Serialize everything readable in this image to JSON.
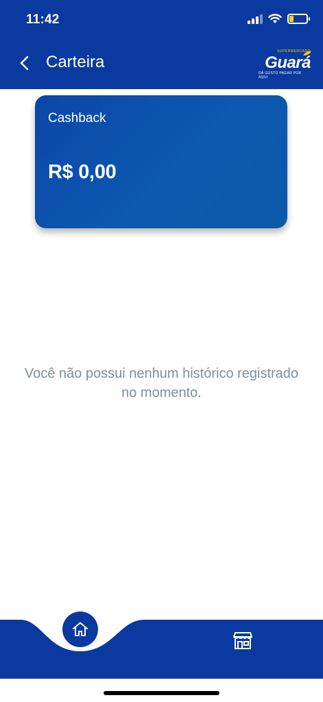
{
  "status_bar": {
    "time": "11:42",
    "icons": [
      "signal-icon",
      "wifi-icon",
      "battery-icon"
    ]
  },
  "header": {
    "title": "Carteira",
    "back_icon": "chevron-left-icon",
    "logo": {
      "wordmark": "Guará",
      "top_text": "SUPERMERCADO",
      "tagline": "DÁ GOSTO PAGAR POR AQUI"
    }
  },
  "cashback_card": {
    "label": "Cashback",
    "value": "R$ 0,00"
  },
  "empty_state": {
    "message": "Você não possui nenhum histórico registrado no momento."
  },
  "bottom_nav": {
    "items": [
      {
        "icon": "home-icon",
        "active": true
      },
      {
        "icon": "store-icon",
        "active": false
      }
    ]
  },
  "colors": {
    "primary": "#0a3a9f",
    "card": "#0b4fac",
    "muted_text": "#7c8f9a",
    "battery_level": "#ffd21f"
  }
}
